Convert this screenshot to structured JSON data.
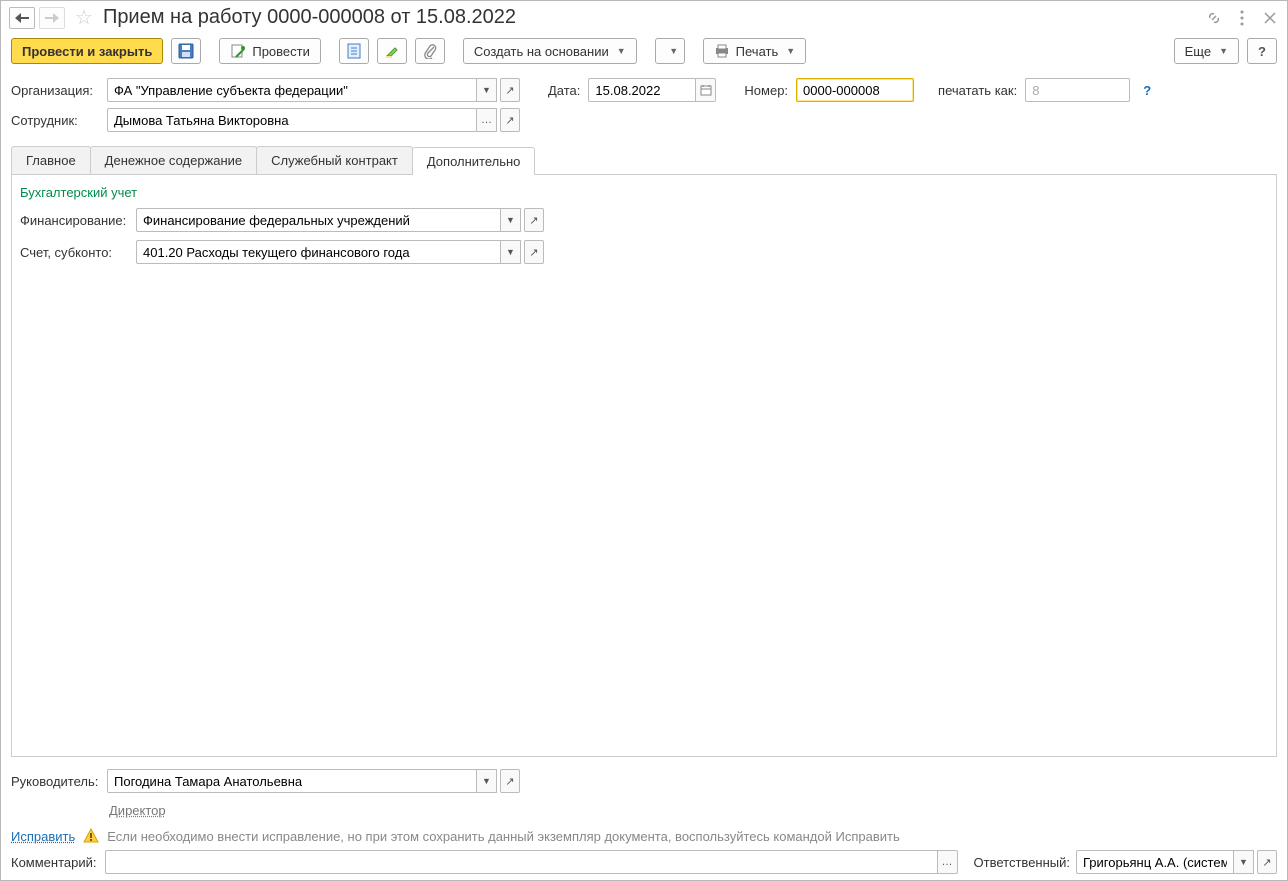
{
  "title": "Прием на работу 0000-000008 от 15.08.2022",
  "toolbar": {
    "post_close": "Провести и закрыть",
    "post": "Провести",
    "create_based": "Создать на основании",
    "print": "Печать",
    "more": "Еще"
  },
  "fields": {
    "org_label": "Организация:",
    "org_value": "ФА \"Управление субъекта федерации\"",
    "date_label": "Дата:",
    "date_value": "15.08.2022",
    "number_label": "Номер:",
    "number_value": "0000-000008",
    "print_as_label": "печатать как:",
    "print_as_value": "8",
    "employee_label": "Сотрудник:",
    "employee_value": "Дымова Татьяна Викторовна"
  },
  "tabs": {
    "main": "Главное",
    "salary": "Денежное содержание",
    "contract": "Служебный контракт",
    "additional": "Дополнительно"
  },
  "additional": {
    "section": "Бухгалтерский учет",
    "financing_label": "Финансирование:",
    "financing_value": "Финансирование федеральных учреждений",
    "account_label": "Счет, субконто:",
    "account_value": "401.20 Расходы текущего финансового года"
  },
  "bottom": {
    "manager_label": "Руководитель:",
    "manager_value": "Погодина Тамара Анатольевна",
    "manager_position": "Директор",
    "fix_link": "Исправить",
    "fix_text": "Если необходимо внести исправление, но при этом сохранить данный экземпляр документа, воспользуйтесь командой Исправить",
    "comment_label": "Комментарий:",
    "comment_value": "",
    "responsible_label": "Ответственный:",
    "responsible_value": "Григорьянц А.А. (системн"
  }
}
